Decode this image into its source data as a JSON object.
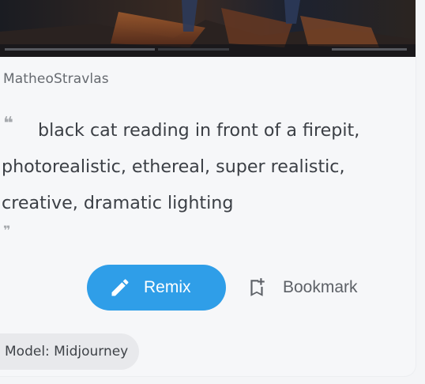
{
  "card": {
    "author": "MatheoStravlas",
    "prompt": "black cat reading in front of a firepit, photorealistic, ethereal, super realistic, creative, dramatic lighting",
    "quote_open_icon": "quote-open-icon",
    "quote_close_icon": "quote-close-icon",
    "actions": {
      "remix_label": "Remix",
      "remix_icon": "pencil-icon",
      "bookmark_label": "Bookmark",
      "bookmark_icon": "bookmark-add-icon"
    },
    "model_badge": "Model: Midjourney"
  },
  "colors": {
    "accent": "#2f9ee8",
    "text_primary": "#3b3f45",
    "text_secondary": "#666a70",
    "badge_bg": "#e8e9ec"
  }
}
